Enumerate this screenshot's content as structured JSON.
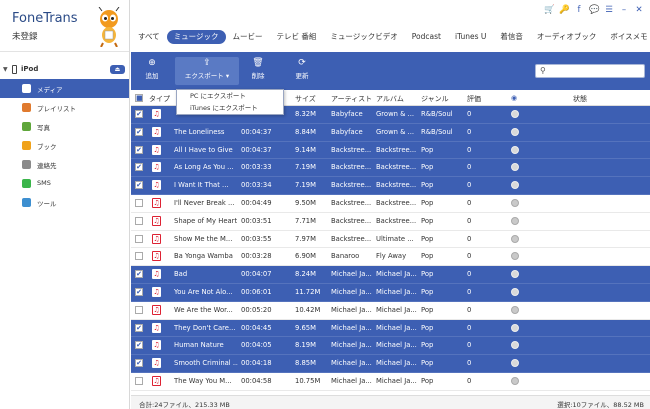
{
  "app": {
    "title": "FoneTrans",
    "subtitle": "未登録"
  },
  "device": {
    "name": "iPod",
    "eject_label": "⏏"
  },
  "sidebar": {
    "items": [
      {
        "label": "メディア",
        "icon": "music-icon",
        "color": "#e0453a",
        "active": true
      },
      {
        "label": "プレイリスト",
        "icon": "playlist-icon",
        "color": "#e07a2e"
      },
      {
        "label": "写真",
        "icon": "photo-icon",
        "color": "#5fa63a"
      },
      {
        "label": "ブック",
        "icon": "book-icon",
        "color": "#f0a21a"
      },
      {
        "label": "連絡先",
        "icon": "contacts-icon",
        "color": "#8a8a8a"
      },
      {
        "label": "SMS",
        "icon": "sms-icon",
        "color": "#3ab54a"
      },
      {
        "label": "ツール",
        "icon": "tools-icon",
        "color": "#3d8fd0"
      }
    ]
  },
  "window_controls": [
    "🛒",
    "🔑",
    "f",
    "💬",
    "☰",
    "–",
    "✕"
  ],
  "tabs": [
    {
      "label": "すべて"
    },
    {
      "label": "ミュージック",
      "active": true
    },
    {
      "label": "ムービー"
    },
    {
      "label": "テレビ 番組"
    },
    {
      "label": "ミュージックビデオ"
    },
    {
      "label": "Podcast"
    },
    {
      "label": "iTunes U"
    },
    {
      "label": "着信音"
    },
    {
      "label": "オーディオブック"
    },
    {
      "label": "ボイスメモ"
    }
  ],
  "toolbar": {
    "add_label": "追加",
    "export_label": "エクスポート",
    "delete_label": "削除",
    "update_label": "更新",
    "search_placeholder": ""
  },
  "export_menu": {
    "items": [
      "PC にエクスポート",
      "iTunes にエクスポート"
    ]
  },
  "table": {
    "headers": {
      "type": "タイプ",
      "size": "サイズ",
      "artist": "アーティスト",
      "album": "アルバム",
      "genre": "ジャンル",
      "rating": "評価",
      "status": "状態"
    },
    "rows": [
      {
        "name": "",
        "time": "",
        "size": "8.32M",
        "artist": "Babyface",
        "album": "Grown & ...",
        "genre": "R&B/Soul",
        "rating": "0",
        "selected": true
      },
      {
        "name": "The Loneliness",
        "time": "00:04:37",
        "size": "8.84M",
        "artist": "Babyface",
        "album": "Grown & ...",
        "genre": "R&B/Soul",
        "rating": "0",
        "selected": true
      },
      {
        "name": "All I Have to Give",
        "time": "00:04:37",
        "size": "9.14M",
        "artist": "Backstree...",
        "album": "Backstree...",
        "genre": "Pop",
        "rating": "0",
        "selected": true
      },
      {
        "name": "As Long As You ...",
        "time": "00:03:33",
        "size": "7.19M",
        "artist": "Backstree...",
        "album": "Backstree...",
        "genre": "Pop",
        "rating": "0",
        "selected": true
      },
      {
        "name": "I Want It That ...",
        "time": "00:03:34",
        "size": "7.19M",
        "artist": "Backstree...",
        "album": "Backstree...",
        "genre": "Pop",
        "rating": "0",
        "selected": true
      },
      {
        "name": "I'll Never Break ...",
        "time": "00:04:49",
        "size": "9.50M",
        "artist": "Backstree...",
        "album": "Backstree...",
        "genre": "Pop",
        "rating": "0",
        "selected": false
      },
      {
        "name": "Shape of My Heart",
        "time": "00:03:51",
        "size": "7.71M",
        "artist": "Backstree...",
        "album": "Backstree...",
        "genre": "Pop",
        "rating": "0",
        "selected": false
      },
      {
        "name": "Show Me the M...",
        "time": "00:03:55",
        "size": "7.97M",
        "artist": "Backstree...",
        "album": "Ultimate ...",
        "genre": "Pop",
        "rating": "0",
        "selected": false
      },
      {
        "name": "Ba Yonga Wamba",
        "time": "00:03:28",
        "size": "6.90M",
        "artist": "Banaroo",
        "album": "Fly Away",
        "genre": "Pop",
        "rating": "0",
        "selected": false
      },
      {
        "name": "Bad",
        "time": "00:04:07",
        "size": "8.24M",
        "artist": "Michael Ja...",
        "album": "Michael Ja...",
        "genre": "Pop",
        "rating": "0",
        "selected": true
      },
      {
        "name": "You Are Not Alo...",
        "time": "00:06:01",
        "size": "11.72M",
        "artist": "Michael Ja...",
        "album": "Michael Ja...",
        "genre": "Pop",
        "rating": "0",
        "selected": true
      },
      {
        "name": "We Are the Wor...",
        "time": "00:05:20",
        "size": "10.42M",
        "artist": "Michael Ja...",
        "album": "Michael Ja...",
        "genre": "Pop",
        "rating": "0",
        "selected": false
      },
      {
        "name": "They Don't Care...",
        "time": "00:04:45",
        "size": "9.65M",
        "artist": "Michael Ja...",
        "album": "Michael Ja...",
        "genre": "Pop",
        "rating": "0",
        "selected": true
      },
      {
        "name": "Human Nature",
        "time": "00:04:05",
        "size": "8.19M",
        "artist": "Michael Ja...",
        "album": "Michael Ja...",
        "genre": "Pop",
        "rating": "0",
        "selected": true
      },
      {
        "name": "Smooth Criminal ...",
        "time": "00:04:18",
        "size": "8.85M",
        "artist": "Michael Ja...",
        "album": "Michael Ja...",
        "genre": "Pop",
        "rating": "0",
        "selected": true
      },
      {
        "name": "The Way You M...",
        "time": "00:04:58",
        "size": "10.75M",
        "artist": "Michael Ja...",
        "album": "Michael Ja...",
        "genre": "Pop",
        "rating": "0",
        "selected": false
      }
    ]
  },
  "status": {
    "left": "合計:24ファイル、215.33 MB",
    "right": "選択:10ファイル、88.52 MB"
  },
  "colors": {
    "accent": "#3d5fb3",
    "music_icon": "#dd2233"
  }
}
